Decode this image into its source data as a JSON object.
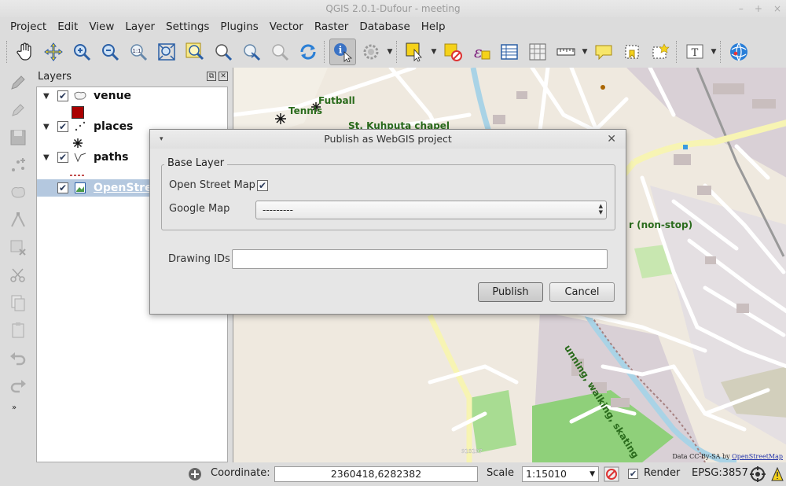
{
  "window": {
    "title": "QGIS 2.0.1-Dufour - meeting",
    "controls": [
      "–",
      "+",
      "×"
    ]
  },
  "menu": [
    "Project",
    "Edit",
    "View",
    "Layer",
    "Settings",
    "Plugins",
    "Vector",
    "Raster",
    "Database",
    "Help"
  ],
  "toolbar_icons": [
    "pan-hand-icon",
    "pan-to-selection-icon",
    "zoom-in-icon",
    "zoom-out-icon",
    "zoom-actual-icon",
    "zoom-full-icon",
    "zoom-layer-icon",
    "zoom-selection-icon",
    "zoom-last-icon",
    "zoom-next-icon",
    "refresh-icon",
    "identify-icon",
    "run-action-icon",
    "select-features-icon",
    "deselect-icon",
    "expression-select-icon",
    "attribute-table-icon",
    "field-calculator-icon",
    "measure-icon",
    "map-tips-icon",
    "bookmark-icon",
    "new-bookmark-icon",
    "text-annotation-icon",
    "web-plugin-icon"
  ],
  "layers_panel": {
    "title": "Layers",
    "layers": [
      {
        "name": "venue",
        "checked": true,
        "symbol": "red-square"
      },
      {
        "name": "places",
        "checked": true,
        "symbol": "star"
      },
      {
        "name": "paths",
        "checked": true,
        "symbol": "dashed-line"
      },
      {
        "name": "OpenStreetMap",
        "display": "OpenStreet",
        "checked": true,
        "selected": true
      }
    ],
    "check_mark": "✔"
  },
  "map_labels": {
    "tennis": "Tennis",
    "futball": "Futball",
    "chapel": "St. Kuhputa chapel",
    "nonstop": "r (non-stop)",
    "running": "unning, walking, skating",
    "attribution_prefix": "Data CC-By-SA by ",
    "attribution_link": "OpenStreetMap"
  },
  "dialog": {
    "title": "Publish as WebGIS project",
    "menu_glyph": "▾",
    "close_glyph": "✕",
    "group_title": "Base Layer",
    "osm_label": "Open Street Map",
    "osm_checked": true,
    "google_label": "Google Map",
    "google_value": "---------",
    "drawing_ids_label": "Drawing IDs",
    "drawing_ids_value": "",
    "publish_label": "Publish",
    "cancel_label": "Cancel"
  },
  "statusbar": {
    "coordinate_label": "Coordinate:",
    "coordinate_value": "2360418,6282382",
    "scale_label": "Scale",
    "scale_value": "1:15010",
    "render_label": "Render",
    "render_checked": true,
    "crs": "EPSG:3857"
  },
  "colors": {
    "map_bg": "#efe9df",
    "road": "#ffffff",
    "river": "#a9d3e6",
    "park": "#c8e7b0",
    "selection": "#b4c8df"
  }
}
